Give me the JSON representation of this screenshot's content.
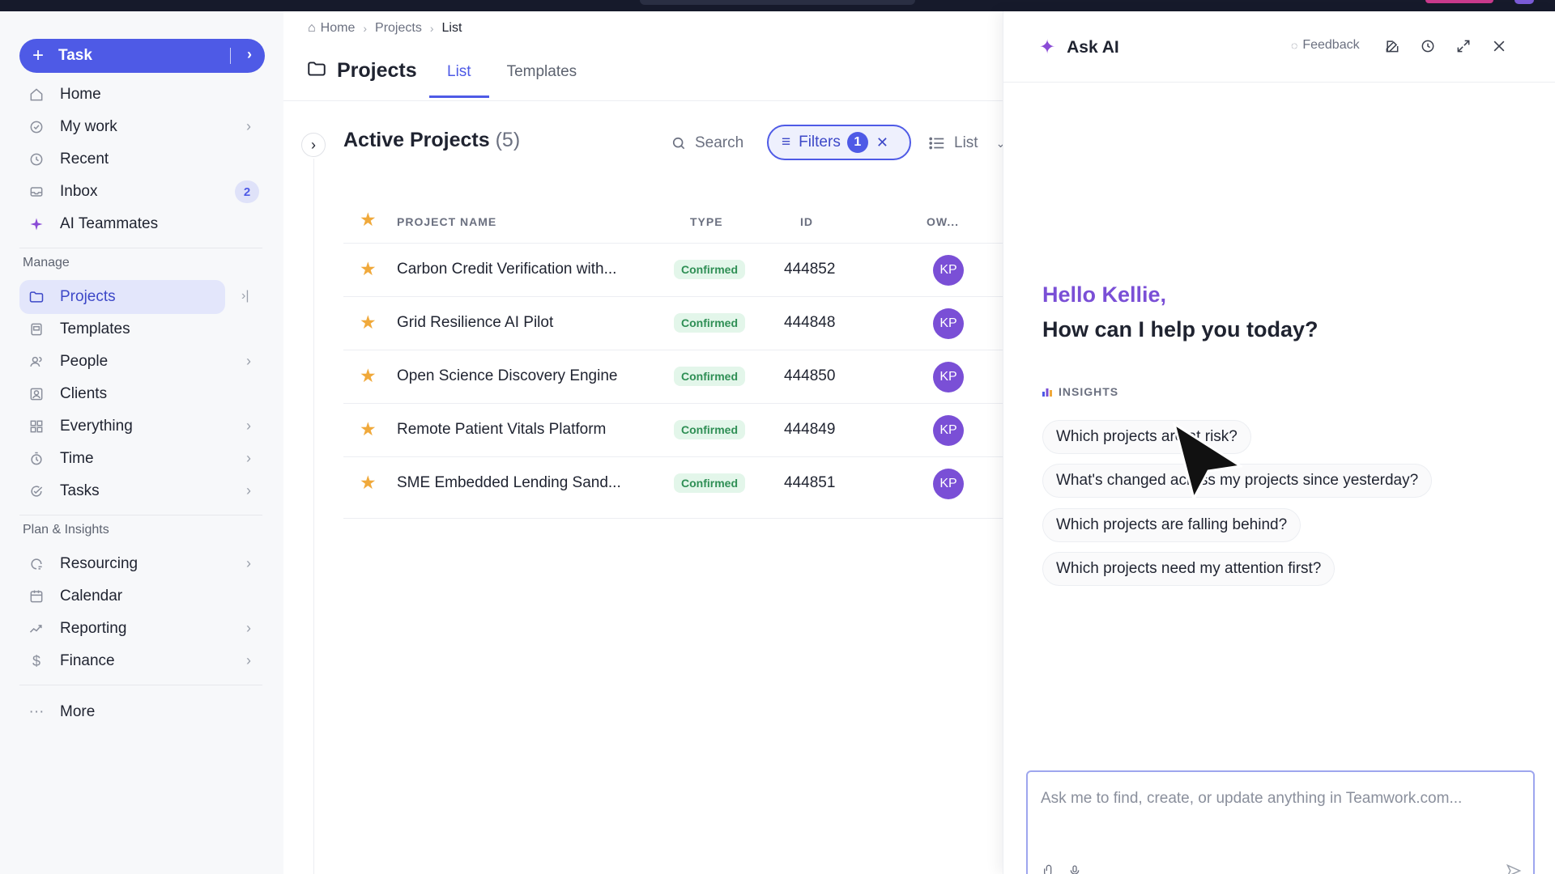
{
  "colors": {
    "accent": "#4e5ae6",
    "ai_purple": "#7a4fd6",
    "confirmed_bg": "#e3f6ea",
    "confirmed_text": "#2f8f55",
    "star": "#f0a93b"
  },
  "sidebar": {
    "task_button": "Task",
    "items": [
      {
        "label": "Home",
        "icon": "home-icon"
      },
      {
        "label": "My work",
        "icon": "check-circle-icon"
      },
      {
        "label": "Recent",
        "icon": "clock-icon"
      },
      {
        "label": "Inbox",
        "icon": "inbox-icon",
        "badge": "2"
      },
      {
        "label": "AI Teammates",
        "icon": "sparkle-icon"
      }
    ],
    "manage_title": "Manage",
    "manage_items": [
      {
        "label": "Projects",
        "icon": "folder-icon"
      },
      {
        "label": "Templates",
        "icon": "template-icon"
      },
      {
        "label": "People",
        "icon": "people-icon"
      },
      {
        "label": "Clients",
        "icon": "clients-icon"
      },
      {
        "label": "Everything",
        "icon": "grid-icon"
      },
      {
        "label": "Time",
        "icon": "stopwatch-icon"
      },
      {
        "label": "Tasks",
        "icon": "task-check-icon"
      }
    ],
    "plan_title": "Plan & Insights",
    "plan_items": [
      {
        "label": "Resourcing",
        "icon": "resourcing-icon"
      },
      {
        "label": "Calendar",
        "icon": "calendar-icon"
      },
      {
        "label": "Reporting",
        "icon": "reporting-icon"
      },
      {
        "label": "Finance",
        "icon": "dollar-icon"
      }
    ],
    "more": "More"
  },
  "main": {
    "breadcrumb": [
      "Home",
      "Projects",
      "List"
    ],
    "title": "Projects",
    "tabs": [
      "List",
      "Templates"
    ],
    "section_title": "Active Projects",
    "section_count": "(5)",
    "search_label": "Search",
    "filters_label": "Filters",
    "filters_count": "1",
    "view_label": "List",
    "columns": {
      "name": "PROJECT NAME",
      "type": "TYPE",
      "id": "ID",
      "owner": "OW..."
    },
    "rows": [
      {
        "name": "Carbon Credit Verification with...",
        "type": "Confirmed",
        "id": "444852",
        "owner": "KP"
      },
      {
        "name": "Grid Resilience AI Pilot",
        "type": "Confirmed",
        "id": "444848",
        "owner": "KP"
      },
      {
        "name": "Open Science Discovery Engine",
        "type": "Confirmed",
        "id": "444850",
        "owner": "KP"
      },
      {
        "name": "Remote Patient Vitals Platform",
        "type": "Confirmed",
        "id": "444849",
        "owner": "KP"
      },
      {
        "name": "SME Embedded Lending Sand...",
        "type": "Confirmed",
        "id": "444851",
        "owner": "KP"
      }
    ]
  },
  "ai": {
    "title": "Ask AI",
    "feedback": "Feedback",
    "greeting": "Hello Kellie,",
    "prompt": "How can I help you today?",
    "insights_label": "INSIGHTS",
    "suggestions": [
      "Which projects are at risk?",
      "What's changed across my projects since yesterday?",
      "Which projects are falling behind?",
      "Which projects need my attention first?"
    ],
    "input_placeholder": "Ask me to find, create, or update anything in Teamwork.com..."
  }
}
